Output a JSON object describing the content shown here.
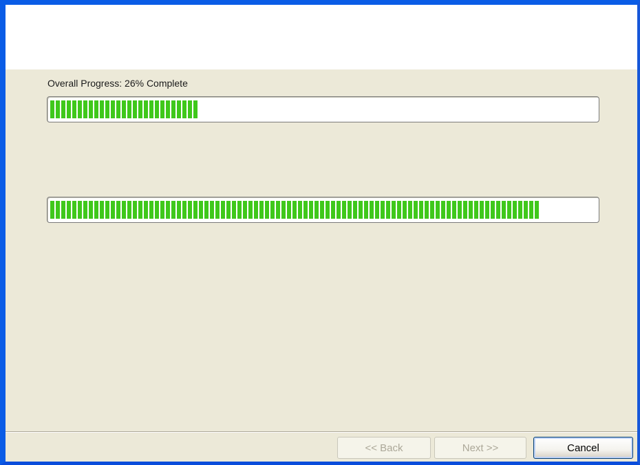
{
  "wizard": {
    "overall_progress_label": "Overall Progress: 26% Complete",
    "overall_progress": 0.275,
    "current_progress": 0.9
  },
  "buttons": {
    "back_label": "<< Back",
    "next_label": "Next >>",
    "cancel_label": "Cancel"
  },
  "colors": {
    "title_bar": "#0a5ce6",
    "face": "#ece9d8",
    "progress_green": "#3fc81b"
  }
}
